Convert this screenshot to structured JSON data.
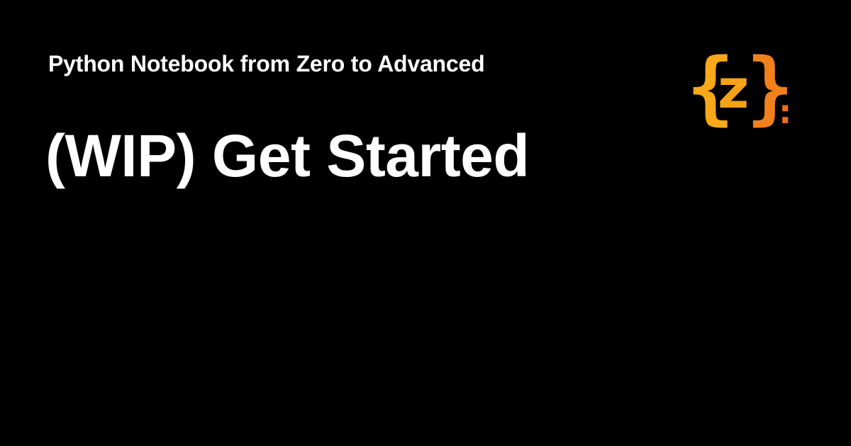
{
  "card": {
    "subtitle": "Python Notebook from Zero to Advanced",
    "title": "(WIP) Get Started"
  },
  "logo": {
    "open_brace": "{",
    "letter": "z",
    "close_brace": "}",
    "colon": ":",
    "colors": {
      "yellow": "#f9a81a",
      "orange": "#ee6c1f"
    }
  },
  "theme": {
    "background": "#000000",
    "text": "#ffffff"
  }
}
